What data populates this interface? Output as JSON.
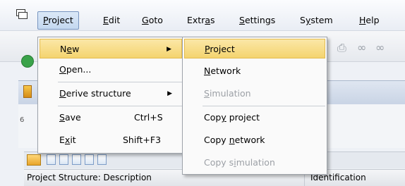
{
  "menubar": {
    "items": [
      {
        "pre": "",
        "u": "P",
        "post": "roject"
      },
      {
        "pre": "",
        "u": "E",
        "post": "dit"
      },
      {
        "pre": "",
        "u": "G",
        "post": "oto"
      },
      {
        "pre": "Extr",
        "u": "a",
        "post": "s"
      },
      {
        "pre": "",
        "u": "S",
        "post": "ettings"
      },
      {
        "pre": "S",
        "u": "y",
        "post": "stem"
      },
      {
        "pre": "",
        "u": "H",
        "post": "elp"
      }
    ]
  },
  "project_menu": {
    "items": [
      {
        "pre": "N",
        "u": "e",
        "post": "w",
        "shortcut": "",
        "submenu": true
      },
      {
        "pre": "",
        "u": "O",
        "post": "pen...",
        "shortcut": "",
        "submenu": false
      },
      {
        "pre": "",
        "u": "D",
        "post": "erive structure",
        "shortcut": "",
        "submenu": true
      },
      {
        "pre": "",
        "u": "S",
        "post": "ave",
        "shortcut": "Ctrl+S",
        "submenu": false
      },
      {
        "pre": "E",
        "u": "x",
        "post": "it",
        "shortcut": "Shift+F3",
        "submenu": false
      }
    ]
  },
  "new_submenu": {
    "items": [
      {
        "pre": "",
        "u": "P",
        "post": "roject",
        "disabled": false
      },
      {
        "pre": "",
        "u": "N",
        "post": "etwork",
        "disabled": false
      },
      {
        "pre": "",
        "u": "S",
        "post": "imulation",
        "disabled": true
      },
      {
        "pre": "Cop",
        "u": "y",
        "post": " project",
        "disabled": false
      },
      {
        "pre": "Copy ",
        "u": "n",
        "post": "etwork",
        "disabled": false
      },
      {
        "pre": "Copy s",
        "u": "i",
        "post": "mulation",
        "disabled": true
      }
    ]
  },
  "background": {
    "partial_label": "6",
    "columns": [
      "Project Structure: Description",
      "Identification"
    ]
  },
  "colors": {
    "highlight": "#f4d46f",
    "active_menu": "#c4d8f0",
    "disabled_text": "#9ca0a6"
  }
}
